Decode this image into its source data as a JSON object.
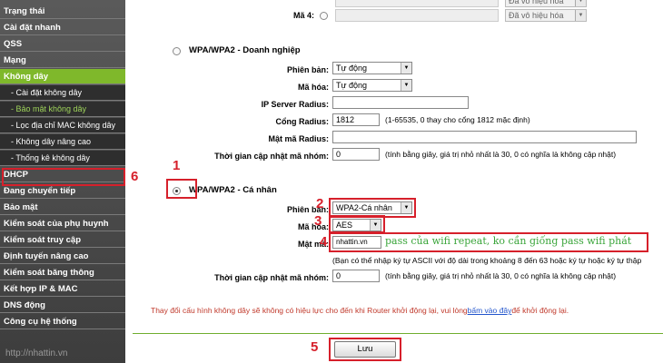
{
  "sidebar": {
    "items": [
      {
        "label": "Trạng thái",
        "type": "main"
      },
      {
        "label": "Cài đặt nhanh",
        "type": "main"
      },
      {
        "label": "QSS",
        "type": "main"
      },
      {
        "label": "Mạng",
        "type": "main"
      },
      {
        "label": "Không dây",
        "type": "active"
      },
      {
        "label": "- Cài đặt không dây",
        "type": "sub"
      },
      {
        "label": "- Bảo mật không dây",
        "type": "sub-current"
      },
      {
        "label": "- Lọc địa chỉ MAC không dây",
        "type": "sub"
      },
      {
        "label": "- Không dây nâng cao",
        "type": "sub"
      },
      {
        "label": "- Thống kê không dây",
        "type": "sub"
      },
      {
        "label": "DHCP",
        "type": "main"
      },
      {
        "label": "Đang chuyển tiếp",
        "type": "main"
      },
      {
        "label": "Bảo mật",
        "type": "main"
      },
      {
        "label": "Kiểm soát của phụ huynh",
        "type": "main"
      },
      {
        "label": "Kiểm soát truy cập",
        "type": "main"
      },
      {
        "label": "Định tuyến nâng cao",
        "type": "main"
      },
      {
        "label": "Kiểm soát băng thông",
        "type": "main"
      },
      {
        "label": "Kết hợp IP & MAC",
        "type": "main"
      },
      {
        "label": "DNS động",
        "type": "main"
      },
      {
        "label": "Công cụ hệ thống",
        "type": "main"
      }
    ],
    "watermark": "http://nhattin.vn"
  },
  "top": {
    "key4_label": "Mã 4:",
    "disabled_option": "Đã vô hiệu hóa"
  },
  "enterprise": {
    "title": "WPA/WPA2 - Doanh nghiệp",
    "version_label": "Phiên bản:",
    "version_value": "Tự động",
    "encryption_label": "Mã hóa:",
    "encryption_value": "Tự động",
    "radius_ip_label": "IP Server Radius:",
    "radius_port_label": "Cổng Radius:",
    "radius_port_value": "1812",
    "radius_port_hint": "(1-65535, 0 thay cho cổng 1812 mặc định)",
    "radius_pass_label": "Mật mã Radius:",
    "group_key_label": "Thời gian cập nhật mã nhóm:",
    "group_key_value": "0",
    "group_key_hint": "(tính bằng giây, giá trị nhỏ nhất là 30, 0 có nghĩa là không cập nhật)"
  },
  "personal": {
    "title": "WPA/WPA2 - Cá nhân",
    "version_label": "Phiên bản:",
    "version_value": "WPA2-Cá nhân",
    "encryption_label": "Mã hóa:",
    "encryption_value": "AES",
    "password_label": "Mật mã:",
    "password_value": "nhattin.vn",
    "password_hint": "(Bạn có thể nhập ký tự ASCII với độ dài trong khoảng 8 đến 63 hoặc ký tự hoặc ký tự thập",
    "group_key_label": "Thời gian cập nhật mã nhóm:",
    "group_key_value": "0",
    "group_key_hint": "(tính bằng giây, giá trị nhỏ nhất là 30, 0 có nghĩa là không cập nhật)"
  },
  "notice": {
    "text_before": "Thay đổi cấu hình không dây sẽ không có hiệu lực cho đến khi Router khởi động lại, vui lòng",
    "link": "bấm vào đây",
    "text_after": "để khởi động lại."
  },
  "save_label": "Lưu",
  "annotation": {
    "n1": "1",
    "n2": "2",
    "n3": "3",
    "n4": "4",
    "n5": "5",
    "n6": "6",
    "note": "pass của wifi repeat, ko cần giống pass wifi phát"
  },
  "colors": {
    "accent": "#7fb82b",
    "annotation": "#d6202b",
    "note": "#3aa53a"
  }
}
